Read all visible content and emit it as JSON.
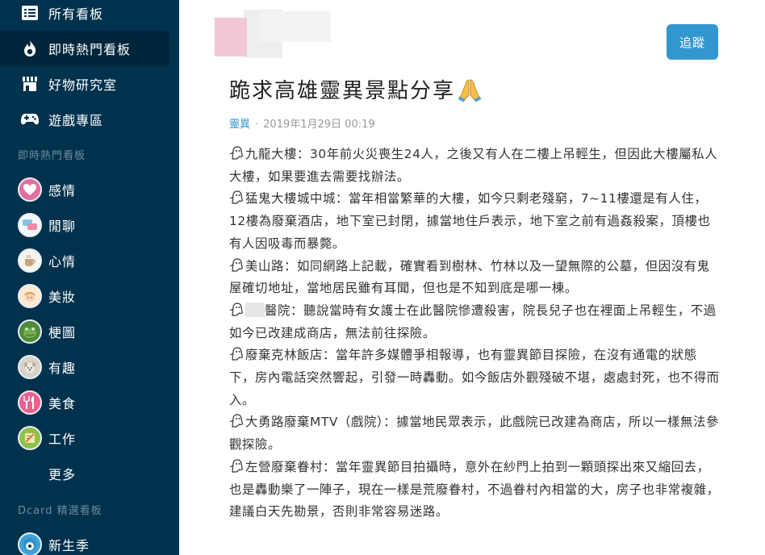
{
  "sidebar": {
    "nav": [
      {
        "label": "所有看板",
        "icon": "list-icon"
      },
      {
        "label": "即時熱門看板",
        "icon": "fire-icon"
      },
      {
        "label": "好物研究室",
        "icon": "store-icon"
      },
      {
        "label": "遊戲專區",
        "icon": "gamepad-icon"
      }
    ],
    "hot_section_title": "即時熱門看板",
    "boards": [
      {
        "label": "感情",
        "icon": "heart-avatar"
      },
      {
        "label": "閒聊",
        "icon": "chat-avatar"
      },
      {
        "label": "心情",
        "icon": "cup-avatar"
      },
      {
        "label": "美妝",
        "icon": "girl-avatar"
      },
      {
        "label": "梗圖",
        "icon": "frog-avatar"
      },
      {
        "label": "有趣",
        "icon": "dog-avatar"
      },
      {
        "label": "美食",
        "icon": "utensils-avatar"
      },
      {
        "label": "工作",
        "icon": "work-avatar"
      }
    ],
    "more_label": "更多",
    "featured_section_title": "Dcard 精選看板",
    "featured": [
      {
        "label": "新生季",
        "icon": "freshman-avatar"
      }
    ]
  },
  "post": {
    "follow_label": "追蹤",
    "title": "跪求高雄靈異景點分享",
    "title_emoji": "pray-emoji",
    "forum": "靈異",
    "separator": "·",
    "date": "2019年1月29日 00:19",
    "paragraphs": [
      {
        "text": "九龍大樓：30年前火災喪生24人，之後又有人在二樓上吊輕生，但因此大樓屬私人大樓，如果要進去需要找辦法。"
      },
      {
        "text": "猛鬼大樓城中城：當年相當繁華的大樓，如今只剩老殘窮，7~11樓還是有人住，12樓為廢棄酒店，地下室已封閉，據當地住戶表示，地下室之前有過姦殺案，頂樓也有人因吸毒而暴斃。"
      },
      {
        "text": "美山路：如同網路上記載，確實看到樹林、竹林以及一望無際的公墓，但因沒有鬼屋確切地址，當地居民雖有耳聞，但也是不知到底是哪一棟。"
      },
      {
        "text": "醫院：聽說當時有女護士在此醫院慘遭殺害，院長兒子也在裡面上吊輕生，不過如今已改建成商店，無法前往探險。",
        "censored_prefix": true
      },
      {
        "text": "廢棄克林飯店：當年許多媒體爭相報導，也有靈異節目探險，在沒有通電的狀態下，房內電話突然響起，引發一時轟動。如今飯店外觀殘破不堪，處處封死，也不得而入。"
      },
      {
        "text": "大勇路廢棄MTV（戲院）：據當地民眾表示，此戲院已改建為商店，所以一樣無法參觀探險。"
      },
      {
        "text": "左營廢棄眷村：當年靈異節目拍攝時，意外在紗門上拍到一顆頭探出來又縮回去，也是轟動樂了一陣子，現在一樣是荒廢眷村，不過眷村內相當的大，房子也非常複雜，建議白天先勘景，否則非常容易迷路。"
      }
    ],
    "bullet_icon": "ghost-icon"
  },
  "colors": {
    "sidebar_bg": "#00324e",
    "accent": "#3397cf",
    "text": "#333333",
    "meta": "#9a9a9a"
  }
}
